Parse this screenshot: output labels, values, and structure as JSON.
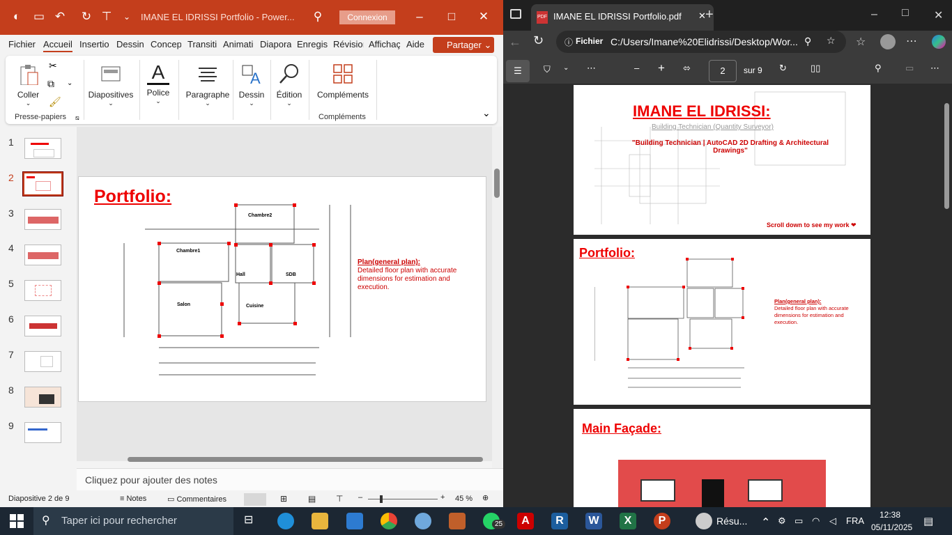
{
  "ppt": {
    "doc_title": "IMANE  EL IDRISSI Portfolio  -  Power...",
    "connexion": "Connexion",
    "menu": [
      "Fichier",
      "Accueil",
      "Insertio",
      "Dessin",
      "Concep",
      "Transiti",
      "Animati",
      "Diapora",
      "Enregis",
      "Révisioı",
      "Affichaç",
      "Aide"
    ],
    "share": "Partager",
    "ribbon": {
      "coller": "Coller",
      "diapositives": "Diapositives",
      "police": "Police",
      "paragraphe": "Paragraphe",
      "dessin": "Dessin",
      "edition": "Édition",
      "complements": "Compléments",
      "group_presse": "Presse-papiers",
      "group_compl": "Compléments"
    },
    "slide_numbers": [
      "1",
      "2",
      "3",
      "4",
      "5",
      "6",
      "7",
      "8",
      "9"
    ],
    "slide": {
      "title": "Portfolio:",
      "plan_heading": "Plan(general plan):",
      "plan_text": "Detailed floor plan with accurate dimensions for estimation and execution.",
      "rooms": [
        "Chambre2",
        "Chambre1",
        "Hall",
        "SDB",
        "Salon",
        "Cuisine"
      ]
    },
    "notes_placeholder": "Cliquez pour ajouter des notes",
    "status": {
      "slide_info": "Diapositive 2 de 9",
      "notes": "Notes",
      "comments": "Commentaires",
      "zoom": "45 %"
    }
  },
  "edge": {
    "tab_title": "IMANE EL IDRISSI Portfolio.pdf",
    "addr_label": "Fichier",
    "url": "C:/Users/Imane%20Elidrissi/Desktop/Wor...",
    "page_num": "2",
    "page_total": "sur 9",
    "page1": {
      "name": "IMANE  EL IDRISSI:",
      "role": "Building Technician (Quantity Surveyor)",
      "tagline": "\"Building Technician | AutoCAD 2D Drafting & Architectural Drawings\"",
      "scroll": "Scroll down to see my work ❤"
    },
    "page2": {
      "title": "Portfolio:",
      "plan_heading": "Plan(general plan):",
      "plan_text": "Detailed floor plan with accurate dimensions for estimation and execution."
    },
    "page3": {
      "title": "Main Façade:"
    }
  },
  "taskbar": {
    "search_placeholder": "Taper ici pour rechercher",
    "whatsapp_badge": "25",
    "resume_label": "Résu...",
    "lang": "FRA",
    "time": "12:38",
    "date": "05/11/2025"
  },
  "colors": {
    "ppt_accent": "#c43e1c",
    "title_red": "#e00000"
  }
}
